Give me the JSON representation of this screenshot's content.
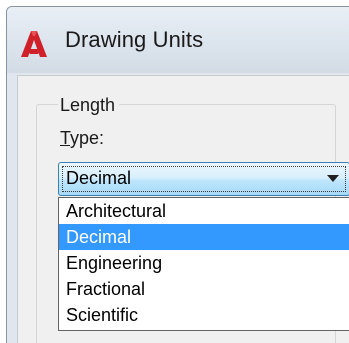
{
  "window": {
    "title": "Drawing Units",
    "app_icon": "autocad-logo-icon"
  },
  "length_group": {
    "label": "Length",
    "type_label_mnemonic": "T",
    "type_label_rest": "ype:",
    "type_combo": {
      "selected": "Decimal",
      "options": [
        "Architectural",
        "Decimal",
        "Engineering",
        "Fractional",
        "Scientific"
      ]
    }
  },
  "colors": {
    "selection": "#3399ff",
    "logo_red": "#d0202a"
  }
}
